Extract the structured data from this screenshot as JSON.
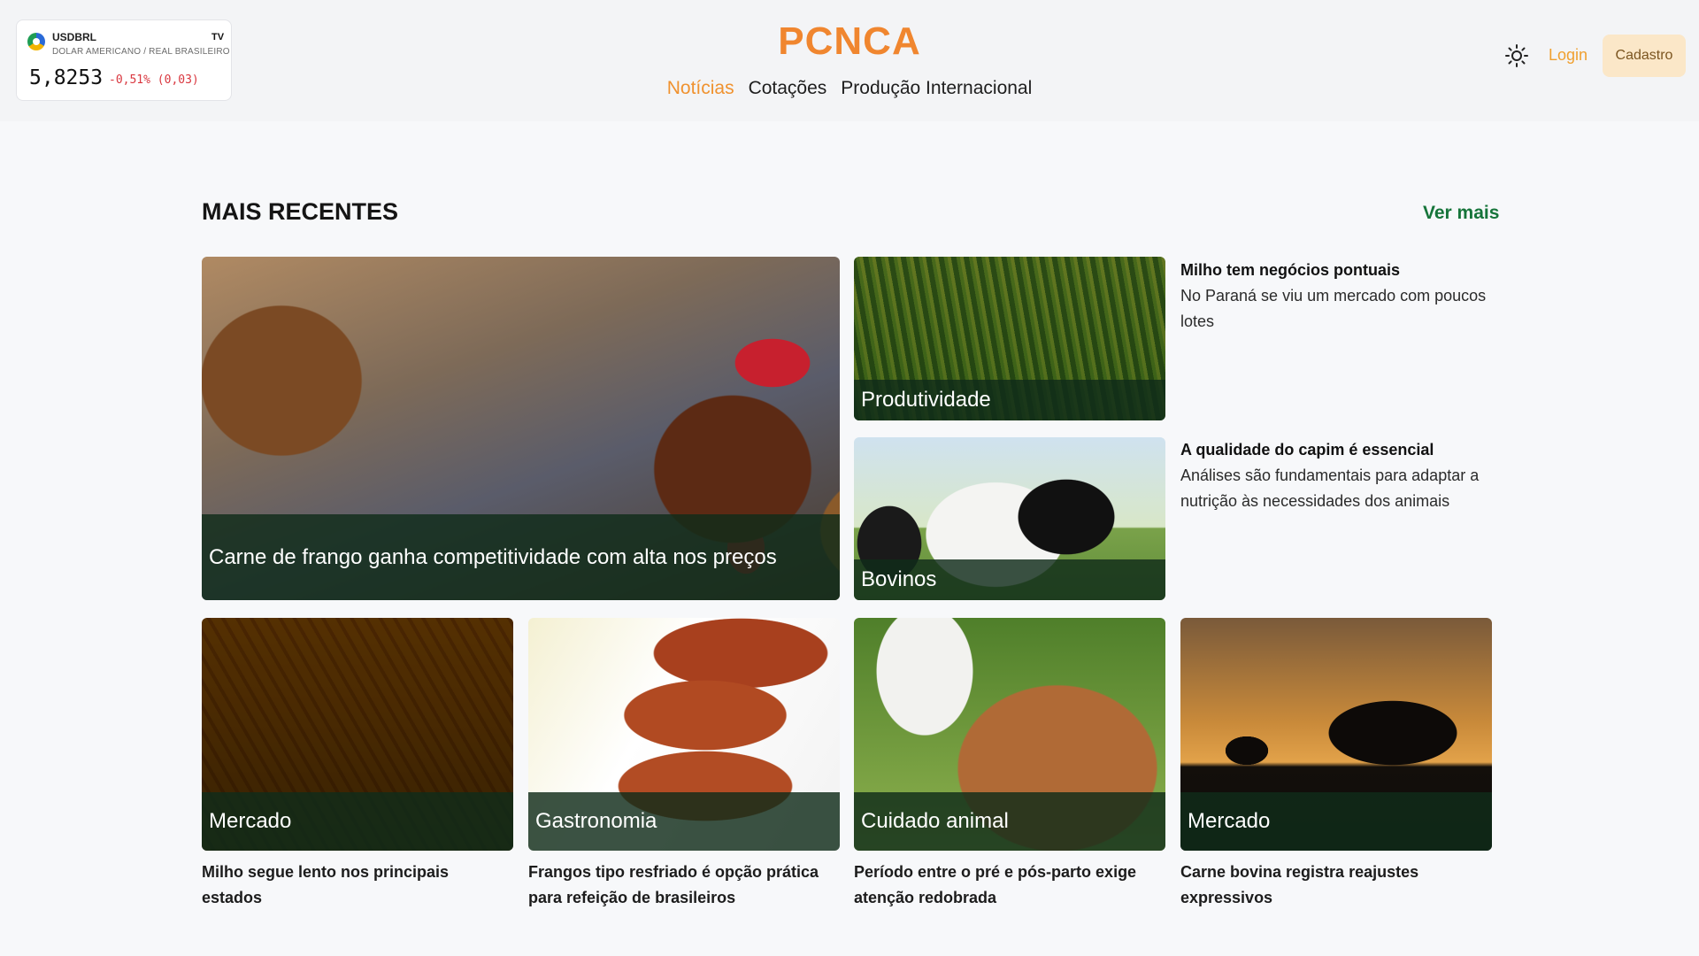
{
  "ticker": {
    "symbol": "USDBRL",
    "name": "DOLAR AMERICANO / REAL BRASILEIRO",
    "price": "5,8253",
    "change": "-0,51% (0,03)",
    "brand_icon": "tv-icon",
    "brand_text": "TV"
  },
  "site": {
    "brand": "PCNCA"
  },
  "nav": {
    "items": [
      {
        "label": "Notícias",
        "active": true
      },
      {
        "label": "Cotações",
        "active": false
      },
      {
        "label": "Produção Internacional",
        "active": false
      }
    ]
  },
  "actions": {
    "login": "Login",
    "cadastro": "Cadastro",
    "theme_icon": "sun-icon"
  },
  "section": {
    "title": "MAIS RECENTES",
    "more": "Ver mais"
  },
  "featured": {
    "label": "Carne de frango ganha competitividade com alta nos preços"
  },
  "side": [
    {
      "tag": "Produtividade",
      "title": "Milho tem negócios pontuais",
      "desc": "No Paraná se viu um mercado com poucos lotes"
    },
    {
      "tag": "Bovinos",
      "title": "A qualidade do capim é essencial",
      "desc": "Análises são fundamentais para adaptar a nutrição às necessidades dos animais"
    }
  ],
  "grid": [
    {
      "tag": "Mercado",
      "caption": "Milho segue lento nos principais estados"
    },
    {
      "tag": "Gastronomia",
      "caption": "Frangos tipo resfriado é opção prática para refeição de brasileiros"
    },
    {
      "tag": "Cuidado animal",
      "caption": "Período entre o pré e pós-parto exige atenção redobrada"
    },
    {
      "tag": "Mercado",
      "caption": "Carne bovina registra reajustes expressivos"
    }
  ],
  "colors": {
    "brand": "#f0862f",
    "link_green": "#16753a",
    "overlay": "#102c1a",
    "negative": "#d9363e"
  }
}
